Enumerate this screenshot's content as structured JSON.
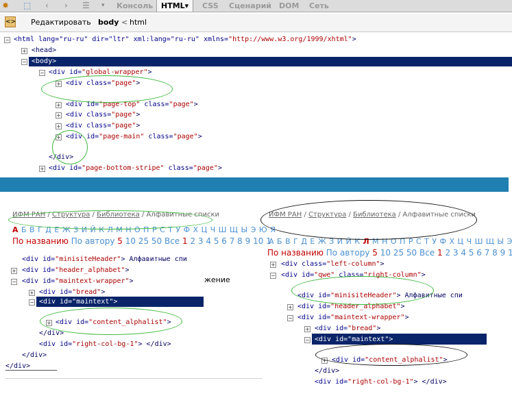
{
  "toolbar": {
    "tabs": [
      "Консоль",
      "HTML",
      "CSS",
      "Сценарий",
      "DOM",
      "Сеть"
    ],
    "active_tab": "HTML",
    "active_arrow": "▾"
  },
  "breadcrumb_bar": {
    "edit_label": "Редактировать",
    "crumb_body": "body",
    "crumb_sep": "<",
    "crumb_html": "html"
  },
  "top_tree": [
    {
      "text_tag": "<html",
      "text_attrs": " lang=\"ru-ru\" dir=\"ltr\" xml:lang=\"ru-ru\" xmlns=",
      "text_val": "\"http://www.w3.org/1999/xhtml\"",
      "text_end": ">"
    },
    {
      "text": "<head>"
    },
    {
      "text": "<body>"
    },
    {
      "text_tag": "<div id=",
      "text_val": "\"global-wrapper\"",
      "text_end": ">"
    },
    {
      "text_tag": "<div class=",
      "text_val": "\"page\"",
      "text_end": ">"
    },
    {
      "text_tag": "<div id=",
      "text_val": "\"page-top\"",
      "text_mid": " class=",
      "text_val2": "\"page\"",
      "text_end": ">"
    },
    {
      "text_tag": "<div class=",
      "text_val": "\"page\"",
      "text_end": ">"
    },
    {
      "text_tag": "<div class=",
      "text_val": "\"page\"",
      "text_end": ">"
    },
    {
      "text_tag": "<div id=",
      "text_val": "\"page-main\"",
      "text_mid": " class=",
      "text_val2": "\"page\"",
      "text_end": ">"
    },
    {
      "text": "</div>"
    },
    {
      "text_tag": "<div id=",
      "text_val": "\"page-bottom-stripe\"",
      "text_mid": " class=",
      "text_val2": "\"page\"",
      "text_end": ">"
    }
  ],
  "left_panel": {
    "breadcrumb": [
      "ИФМ РАН",
      "Структура",
      "Библиотека",
      "Алфавитные списки"
    ],
    "alphabet_first": "А",
    "alphabet_rest": "Б В Г Д Е Ж З И Й К Л М Н О П Р С Т У Ф Х Ц Ч Ш Щ Ы Э Ю Я",
    "sort_active": "По названию",
    "sort_other": "По автору",
    "page_sizes_first": "5",
    "page_sizes_rest": "10 25 50 Все",
    "pages_first": "1",
    "pages_rest": "2 3 4 5 6 7 8 9 10 1",
    "overlay_text": "жение",
    "tree": [
      {
        "pre": "<div id=",
        "val": "\"minisiteHeader\"",
        "post": "> Алфавитные спи"
      },
      {
        "pre": "<div id=",
        "val": "\"header_alphabet\"",
        "post": ">"
      },
      {
        "pre": "<div id=",
        "val": "\"maintext-wrapper\"",
        "post": ">"
      },
      {
        "pre": "<div id=",
        "val": "\"bread\"",
        "post": ">"
      },
      {
        "pre": "<div id=",
        "val": "\"maintext\"",
        "post": ">"
      },
      {
        "pre": "<div id=",
        "val": "\"content_alphalist\"",
        "post": ">"
      },
      {
        "pre": "</div>",
        "val": "",
        "post": ""
      },
      {
        "pre": "<div id=",
        "val": "\"right-col-bg-1\"",
        "post": "> </div>"
      },
      {
        "pre": "</div>",
        "val": "",
        "post": ""
      },
      {
        "pre": "</div>",
        "val": "",
        "post": ""
      }
    ]
  },
  "right_panel": {
    "breadcrumb": [
      "ИФМ РАН",
      "Структура",
      "Библиотека",
      "Алфавитные списки"
    ],
    "alphabet_a": "А Б В Г Д Е Ж З И Й К",
    "alphabet_active": "Л",
    "alphabet_b": "М Н О П Р С Т У Ф Х Ц Ч Ш Щ Ы Э Ю",
    "sort_active": "По названию",
    "sort_other": "По автору",
    "page_sizes_first": "5",
    "page_sizes_rest": "10 25 50 Все",
    "pages_first": "1",
    "pages_rest": "2 3 4 5 6 7 8 9 10",
    "tree": [
      {
        "pre": "<div class=",
        "val": "\"left-column\"",
        "post": ">"
      },
      {
        "pre": "<div id=",
        "val": "\"qwe\"",
        "mid": " class=",
        "val2": "\"right-column\"",
        "post": ">"
      },
      {
        "pre": "<div id=",
        "val": "\"minisiteHeader\"",
        "post": "> Алфавитные спи"
      },
      {
        "pre": "<div id=",
        "val": "\"header_alphabet\"",
        "post": ">"
      },
      {
        "pre": "<div id=",
        "val": "\"maintext-wrapper\"",
        "post": ">"
      },
      {
        "pre": "<div id=",
        "val": "\"bread\"",
        "post": ">"
      },
      {
        "pre": "<div id=",
        "val": "\"maintext\"",
        "post": ">"
      },
      {
        "pre": "<div id=",
        "val": "\"content_alphalist\"",
        "post": ">"
      },
      {
        "pre": "</div>",
        "val": "",
        "post": ""
      },
      {
        "pre": "<div id=",
        "val": "\"right-col-bg-1\"",
        "post": "> </div>"
      }
    ]
  },
  "colors": {
    "selection": "#0a246a",
    "banner": "#1f7fb0",
    "green_marker": "#3cb83c",
    "black_marker": "#111111",
    "link_blue": "#4a8fd0",
    "active_red": "#c00000"
  }
}
